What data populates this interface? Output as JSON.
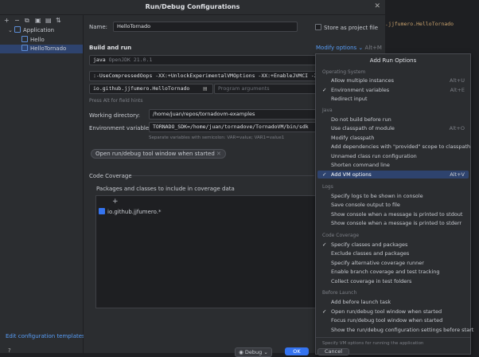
{
  "dialog_title": "Run/Debug Configurations",
  "sidebar": {
    "toolbar_icons": [
      "+",
      "−",
      "⧉",
      "▣",
      "▤",
      "⇅"
    ],
    "tree": [
      {
        "label": "Application",
        "level": 0,
        "expanded": true
      },
      {
        "label": "Hello",
        "level": 1
      },
      {
        "label": "HelloTornado",
        "level": 1,
        "selected": true
      }
    ],
    "edit_templates": "Edit configuration templates...",
    "help": "?"
  },
  "form": {
    "name_label": "Name:",
    "name_value": "HelloTornado",
    "store_label": "Store as project file",
    "build_run_label": "Build and run",
    "modify_options": "Modify options",
    "modify_shortcut": "Alt+M",
    "jdk_value": "java",
    "jdk_version": "OpenJDK 21.0.1",
    "vm_options": ":-UseCompressedOops -XX:+UnlockExperimentalVMOptions -XX:+EnableJVMCI -X",
    "main_class": "io.github.jjfumero.HelloTornado",
    "program_args_placeholder": "Program arguments",
    "press_alt_hint": "Press Alt for field hints",
    "working_dir_label": "Working directory:",
    "working_dir_value": "/home/juan/repos/tornadovm-examples",
    "env_label": "Environment variables:",
    "env_value": "TORNADO_SDK=/home/juan/tornadove/TornadoVM/bin/sdk",
    "env_hint": "Separate variables with semicolon: VAR=value; VAR1=value1",
    "open_tool_window_tag": "Open run/debug tool window when started",
    "coverage_label": "Code Coverage",
    "coverage_packages_label": "Packages and classes to include in coverage data",
    "coverage_add": "+",
    "coverage_entry": "io.github.jjfumero.*"
  },
  "buttons": {
    "debug": "Debug",
    "ok": "OK",
    "cancel": "Cancel"
  },
  "editor_text": ".jjfumero.HelloTornado",
  "popup": {
    "title": "Add Run Options",
    "footer": "Specify VM options for running the application",
    "sections": [
      {
        "label": "Operating System",
        "items": [
          {
            "label": "Allow multiple instances",
            "shortcut": "Alt+U"
          },
          {
            "label": "Environment variables",
            "shortcut": "Alt+E",
            "checked": true
          },
          {
            "label": "Redirect input"
          }
        ]
      },
      {
        "label": "Java",
        "items": [
          {
            "label": "Do not build before run"
          },
          {
            "label": "Use classpath of module",
            "shortcut": "Alt+O"
          },
          {
            "label": "Modify classpath"
          },
          {
            "label": "Add dependencies with \"provided\" scope to classpath"
          },
          {
            "label": "Unnamed class run configuration"
          },
          {
            "label": "Shorten command line"
          },
          {
            "label": "Add VM options",
            "shortcut": "Alt+V",
            "checked": true,
            "selected": true
          }
        ]
      },
      {
        "label": "Logs",
        "items": [
          {
            "label": "Specify logs to be shown in console"
          },
          {
            "label": "Save console output to file"
          },
          {
            "label": "Show console when a message is printed to stdout"
          },
          {
            "label": "Show console when a message is printed to stderr"
          }
        ]
      },
      {
        "label": "Code Coverage",
        "items": [
          {
            "label": "Specify classes and packages",
            "checked": true
          },
          {
            "label": "Exclude classes and packages"
          },
          {
            "label": "Specify alternative coverage runner"
          },
          {
            "label": "Enable branch coverage and test tracking"
          },
          {
            "label": "Collect coverage in test folders"
          }
        ]
      },
      {
        "label": "Before Launch",
        "items": [
          {
            "label": "Add before launch task"
          },
          {
            "label": "Open run/debug tool window when started",
            "checked": true
          },
          {
            "label": "Focus run/debug tool window when started"
          },
          {
            "label": "Show the run/debug configuration settings before start"
          }
        ]
      }
    ]
  },
  "colors": {
    "accent": "#3574f0",
    "selection": "#2e436e",
    "background": "#2b2d30",
    "link": "#589df6"
  }
}
